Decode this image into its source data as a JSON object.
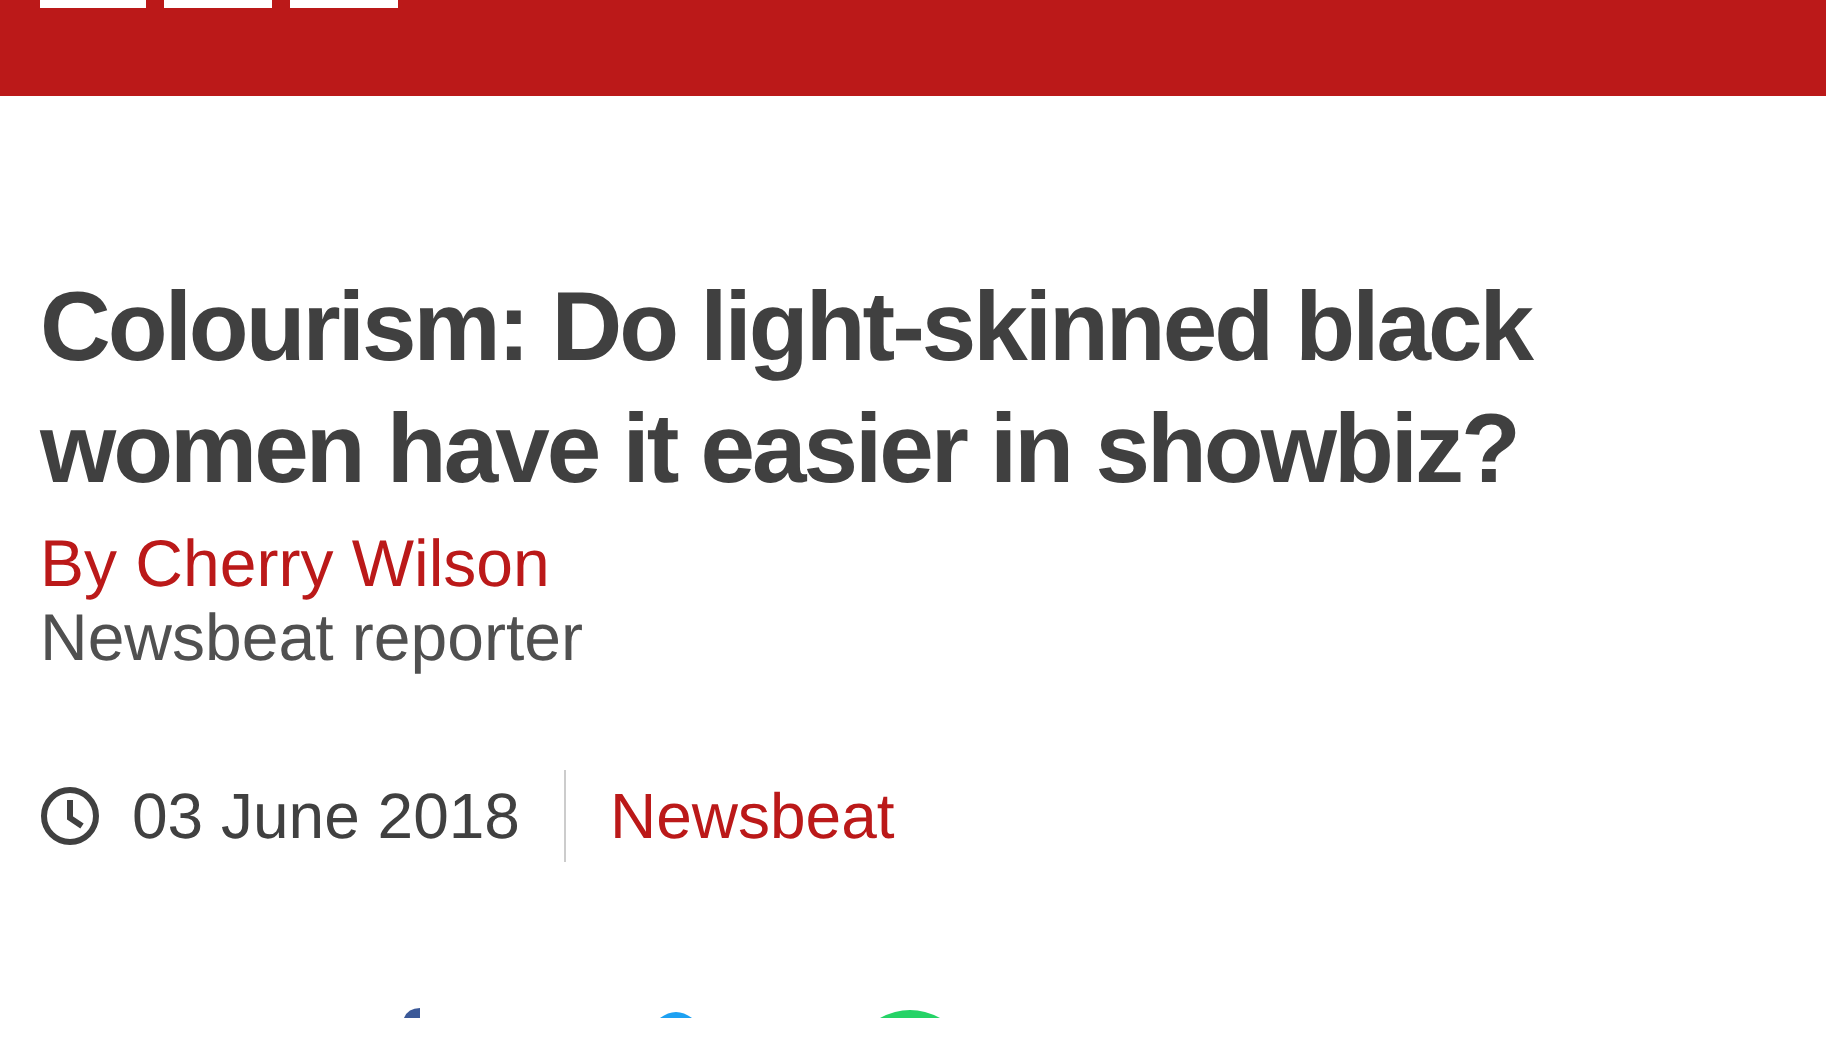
{
  "article": {
    "headline": "Colourism: Do light-skinned black women have it easier in showbiz?",
    "byline": "By Cherry Wilson",
    "role": "Newsbeat reporter",
    "date": "03 June 2018",
    "section": "Newsbeat"
  }
}
